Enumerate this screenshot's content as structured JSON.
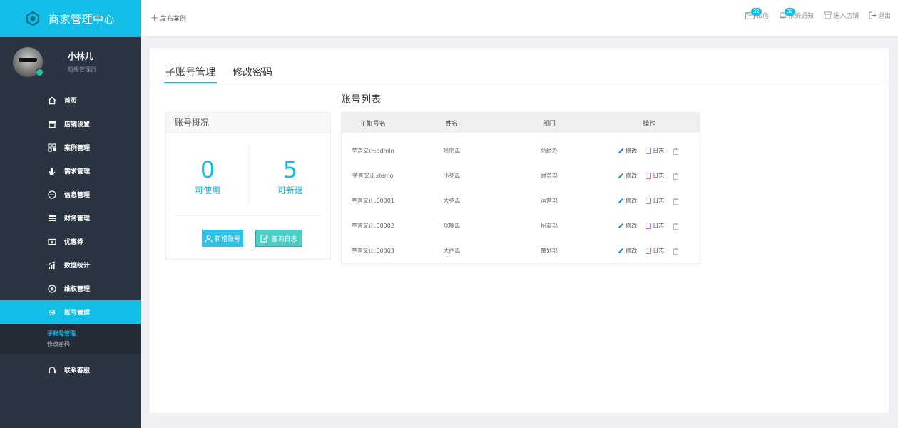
{
  "brand": {
    "title": "商家管理中心",
    "icon": "logo-icon"
  },
  "profile": {
    "name": "小林儿",
    "role": "超级管理员"
  },
  "nav": {
    "items": [
      {
        "label": "首页",
        "icon": "home-icon"
      },
      {
        "label": "店铺设置",
        "icon": "store-icon"
      },
      {
        "label": "案例管理",
        "icon": "grid-icon"
      },
      {
        "label": "需求管理",
        "icon": "hand-icon"
      },
      {
        "label": "信息管理",
        "icon": "chat-icon"
      },
      {
        "label": "财务管理",
        "icon": "coins-icon"
      },
      {
        "label": "优惠券",
        "icon": "coupon-icon"
      },
      {
        "label": "数据统计",
        "icon": "chart-icon"
      },
      {
        "label": "维权管理",
        "icon": "yuan-icon"
      },
      {
        "label": "账号管理",
        "icon": "gear-icon"
      }
    ],
    "sub": [
      {
        "label": "子账号管理"
      },
      {
        "label": "修改密码"
      }
    ],
    "contact": {
      "label": "联系客服",
      "icon": "headset-icon"
    },
    "accent": "#12bde8"
  },
  "header": {
    "publish": "发布案例",
    "messages": {
      "label": "私信",
      "count": "32"
    },
    "notices": {
      "label": "系统通知",
      "count": "32"
    },
    "store": "进入店铺",
    "logout": "退出"
  },
  "tabs": [
    {
      "label": "子账号管理"
    },
    {
      "label": "修改密码"
    }
  ],
  "overview": {
    "title": "账号概况",
    "available": {
      "value": "0",
      "label": "可使用"
    },
    "creatable": {
      "value": "5",
      "label": "可新建"
    },
    "add_button": "新增账号",
    "log_button": "查询日志"
  },
  "list": {
    "title": "账号列表",
    "headers": [
      "子帐号名",
      "姓名",
      "部门",
      "操作"
    ],
    "rows": [
      {
        "account": "芋言又止:admin",
        "name": "哈密瓜",
        "dept": "总经办"
      },
      {
        "account": "芋言又止:demo",
        "name": "小冬瓜",
        "dept": "财务部"
      },
      {
        "account": "芋言又止:00001",
        "name": "大冬瓜",
        "dept": "运营部"
      },
      {
        "account": "芋言又止:00002",
        "name": "咪咪瓜",
        "dept": "招商部"
      },
      {
        "account": "芋言又止:00003",
        "name": "大西瓜",
        "dept": "策划部"
      }
    ],
    "edit_label": "修改",
    "log_label": "日志"
  }
}
